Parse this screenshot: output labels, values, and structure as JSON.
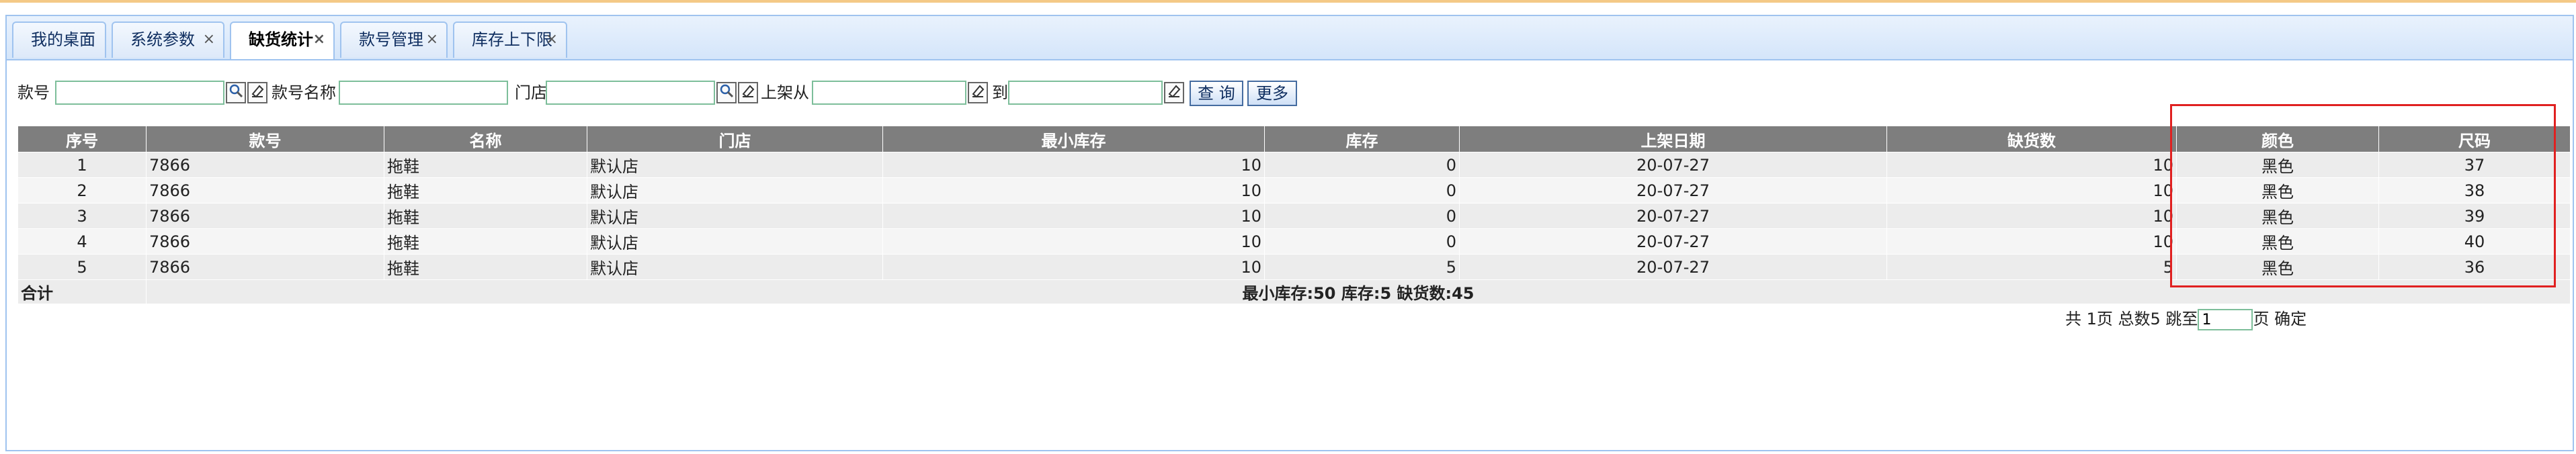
{
  "tabs": [
    {
      "label": "我的桌面",
      "closable": false
    },
    {
      "label": "系统参数",
      "closable": true
    },
    {
      "label": "缺货统计",
      "closable": true,
      "active": true
    },
    {
      "label": "款号管理",
      "closable": true
    },
    {
      "label": "库存上下限",
      "closable": true
    }
  ],
  "close_glyph": "×",
  "filters": {
    "style_no_label": "款号",
    "style_name_label": "款号名称",
    "store_label": "门店",
    "shelf_from_label": "上架从",
    "to_label": "到",
    "query_button": "查 询",
    "more_button": "更多"
  },
  "icons": {
    "search": "search-icon",
    "clear": "eraser-icon"
  },
  "table": {
    "columns": [
      "序号",
      "款号",
      "名称",
      "门店",
      "最小库存",
      "库存",
      "上架日期",
      "缺货数",
      "颜色",
      "尺码"
    ],
    "rows": [
      [
        "1",
        "7866",
        "拖鞋",
        "默认店",
        "10",
        "0",
        "20-07-27",
        "10",
        "黑色",
        "37"
      ],
      [
        "2",
        "7866",
        "拖鞋",
        "默认店",
        "10",
        "0",
        "20-07-27",
        "10",
        "黑色",
        "38"
      ],
      [
        "3",
        "7866",
        "拖鞋",
        "默认店",
        "10",
        "0",
        "20-07-27",
        "10",
        "黑色",
        "39"
      ],
      [
        "4",
        "7866",
        "拖鞋",
        "默认店",
        "10",
        "0",
        "20-07-27",
        "10",
        "黑色",
        "40"
      ],
      [
        "5",
        "7866",
        "拖鞋",
        "默认店",
        "10",
        "5",
        "20-07-27",
        "5",
        "黑色",
        "36"
      ]
    ],
    "footer_label": "合计",
    "footer_summary": "最小库存:50 库存:5 缺货数:45"
  },
  "pager": {
    "text_before": "共 1页 总数5 跳至",
    "page_value": "1",
    "text_after": "页 确定"
  },
  "colors": {
    "highlight": "#e02020",
    "header_bg": "#7e7e7e",
    "tab_border": "#9fc3ef"
  }
}
